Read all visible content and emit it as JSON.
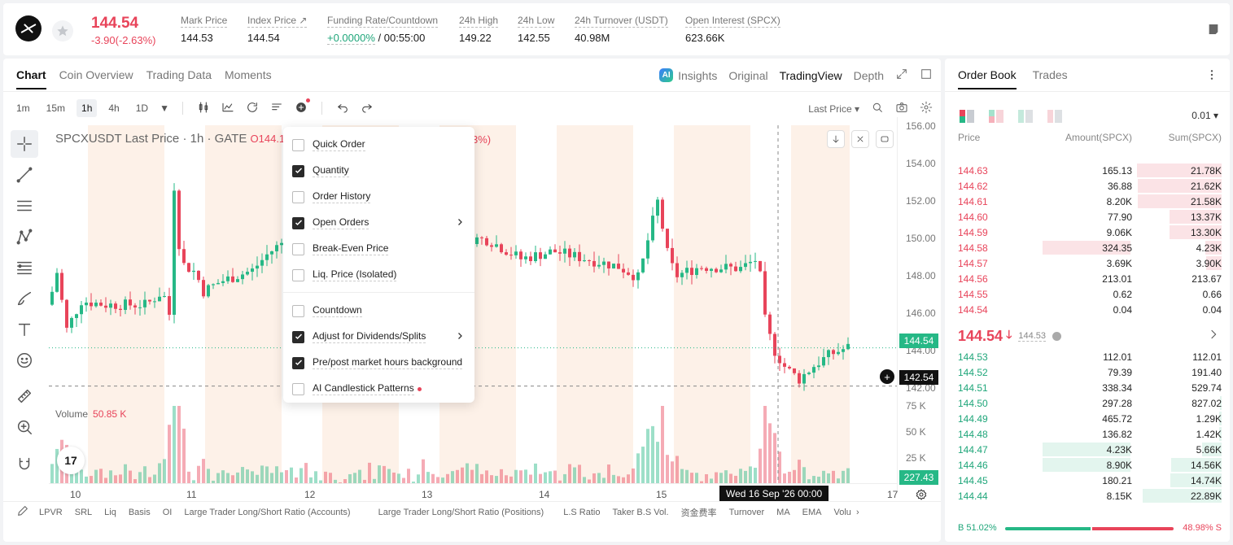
{
  "header": {
    "last_price": "144.54",
    "change": "-3.90(-2.63%)",
    "stats": [
      {
        "label": "Mark Price",
        "value": "144.53"
      },
      {
        "label": "Index Price ↗",
        "value": "144.54"
      },
      {
        "label": "Funding Rate/Countdown",
        "value_green": "+0.0000%",
        "value": " / 00:55:00"
      },
      {
        "label": "24h High",
        "value": "149.22"
      },
      {
        "label": "24h Low",
        "value": "142.55"
      },
      {
        "label": "24h Turnover (USDT)",
        "value": "40.98M"
      },
      {
        "label": "Open Interest (SPCX)",
        "value": "623.66K"
      }
    ]
  },
  "chart_tabs": [
    "Chart",
    "Coin Overview",
    "Trading Data",
    "Moments"
  ],
  "view_tabs": {
    "insights": "Insights",
    "ai": "AI",
    "original": "Original",
    "tradingview": "TradingView",
    "depth": "Depth"
  },
  "toolbar": {
    "intervals": [
      "1m",
      "15m",
      "1h",
      "4h",
      "1D"
    ],
    "active_interval": "1h",
    "price_type": "Last Price"
  },
  "legend": {
    "title": "SPCXUSDT Last Price · 1h · GATE",
    "o": "O144.13",
    "pct": "3%)"
  },
  "volume": {
    "label": "Volume",
    "value": "50.85 K"
  },
  "tv_logo": "17",
  "y_axis": {
    "ticks": [
      "156.00",
      "154.00",
      "152.00",
      "150.00",
      "148.00",
      "146.00",
      "144.00",
      "142.00"
    ],
    "vol_ticks": [
      "75 K",
      "50 K",
      "25 K"
    ],
    "last_tag": "144.54",
    "cross_tag": "142.54",
    "vol_tag": "227.43"
  },
  "x_axis": {
    "labels": [
      "10",
      "11",
      "12",
      "13",
      "14",
      "15",
      "17"
    ],
    "crosshair": "Wed 16 Sep '26   00:00"
  },
  "indicators": [
    "LPVR",
    "SRL",
    "Liq",
    "Basis",
    "OI",
    "Large Trader Long/Short Ratio (Accounts)",
    "Large Trader Long/Short Ratio (Positions)",
    "L.S Ratio",
    "Taker B.S Vol.",
    "资金费率",
    "Turnover",
    "MA",
    "EMA",
    "Volu"
  ],
  "dropdown": {
    "group1": [
      {
        "label": "Quick Order",
        "checked": false
      },
      {
        "label": "Quantity",
        "checked": true
      },
      {
        "label": "Order History",
        "checked": false
      },
      {
        "label": "Open Orders",
        "checked": true,
        "submenu": true
      },
      {
        "label": "Break-Even Price",
        "checked": false
      },
      {
        "label": "Liq. Price (Isolated)",
        "checked": false
      }
    ],
    "group2": [
      {
        "label": "Countdown",
        "checked": false
      },
      {
        "label": "Adjust for Dividends/Splits",
        "checked": true,
        "submenu": true
      },
      {
        "label": "Pre/post market hours background",
        "checked": true
      },
      {
        "label": "AI Candlestick Patterns",
        "checked": false,
        "new": true
      }
    ]
  },
  "orderbook": {
    "tabs": [
      "Order Book",
      "Trades"
    ],
    "precision": "0.01",
    "headers": {
      "price": "Price",
      "amount": "Amount(SPCX)",
      "sum": "Sum(SPCX)"
    },
    "asks": [
      {
        "price": "144.63",
        "amount": "165.13",
        "sum": "21.78K",
        "depth": 0.95,
        "amt_bar": 0
      },
      {
        "price": "144.62",
        "amount": "36.88",
        "sum": "21.62K",
        "depth": 0.94,
        "amt_bar": 0
      },
      {
        "price": "144.61",
        "amount": "8.20K",
        "sum": "21.58K",
        "depth": 0.94,
        "amt_bar": 0
      },
      {
        "price": "144.60",
        "amount": "77.90",
        "sum": "13.37K",
        "depth": 0.58,
        "amt_bar": 0
      },
      {
        "price": "144.59",
        "amount": "9.06K",
        "sum": "13.30K",
        "depth": 0.58,
        "amt_bar": 0
      },
      {
        "price": "144.58",
        "amount": "324.35",
        "sum": "4.23K",
        "depth": 0.18,
        "amt_bar": 0.6
      },
      {
        "price": "144.57",
        "amount": "3.69K",
        "sum": "3.90K",
        "depth": 0.17,
        "amt_bar": 0
      },
      {
        "price": "144.56",
        "amount": "213.01",
        "sum": "213.67",
        "depth": 0,
        "amt_bar": 0
      },
      {
        "price": "144.55",
        "amount": "0.62",
        "sum": "0.66",
        "depth": 0,
        "amt_bar": 0
      },
      {
        "price": "144.54",
        "amount": "0.04",
        "sum": "0.04",
        "depth": 0,
        "amt_bar": 0
      }
    ],
    "mid": {
      "price": "144.54",
      "mark": "144.53"
    },
    "bids": [
      {
        "price": "144.53",
        "amount": "112.01",
        "sum": "112.01",
        "depth": 0,
        "amt_bar": 0
      },
      {
        "price": "144.52",
        "amount": "79.39",
        "sum": "191.40",
        "depth": 0,
        "amt_bar": 0
      },
      {
        "price": "144.51",
        "amount": "338.34",
        "sum": "529.74",
        "depth": 0,
        "amt_bar": 0
      },
      {
        "price": "144.50",
        "amount": "297.28",
        "sum": "827.02",
        "depth": 0.02,
        "amt_bar": 0
      },
      {
        "price": "144.49",
        "amount": "465.72",
        "sum": "1.29K",
        "depth": 0.03,
        "amt_bar": 0
      },
      {
        "price": "144.48",
        "amount": "136.82",
        "sum": "1.42K",
        "depth": 0.03,
        "amt_bar": 0
      },
      {
        "price": "144.47",
        "amount": "4.23K",
        "sum": "5.66K",
        "depth": 0.22,
        "amt_bar": 0.6
      },
      {
        "price": "144.46",
        "amount": "8.90K",
        "sum": "14.56K",
        "depth": 0.56,
        "amt_bar": 0.6
      },
      {
        "price": "144.45",
        "amount": "180.21",
        "sum": "14.74K",
        "depth": 0.57,
        "amt_bar": 0
      },
      {
        "price": "144.44",
        "amount": "8.15K",
        "sum": "22.89K",
        "depth": 0.88,
        "amt_bar": 0
      }
    ],
    "buy_ratio": "B 51.02%",
    "sell_ratio": "48.98% S",
    "buy_fraction": 0.5102
  },
  "colors": {
    "up": "#26b886",
    "down": "#e8445a",
    "bg_session": "#fdf1e8"
  }
}
